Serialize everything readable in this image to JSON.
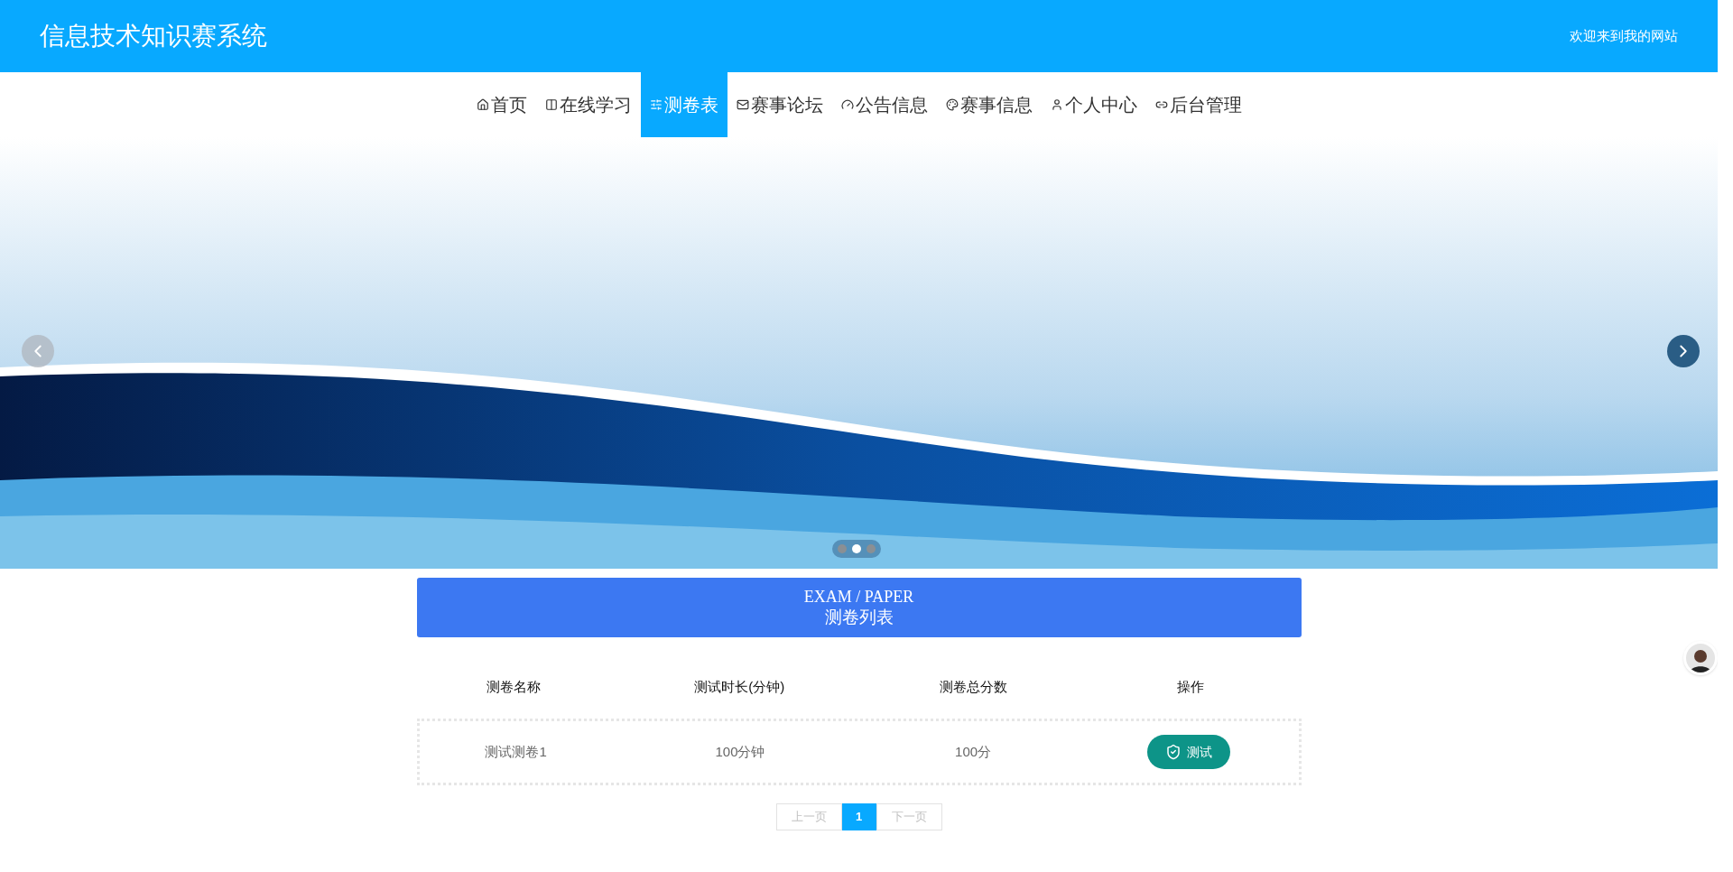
{
  "header": {
    "title": "信息技术知识赛系统",
    "welcome": "欢迎来到我的网站"
  },
  "nav": [
    {
      "label": "首页",
      "selected": false
    },
    {
      "label": "在线学习",
      "selected": false
    },
    {
      "label": "测卷表",
      "selected": true
    },
    {
      "label": "赛事论坛",
      "selected": false
    },
    {
      "label": "公告信息",
      "selected": false
    },
    {
      "label": "赛事信息",
      "selected": false
    },
    {
      "label": "个人中心",
      "selected": false
    },
    {
      "label": "后台管理",
      "selected": false
    }
  ],
  "carousel": {
    "dots": [
      {
        "selected": false
      },
      {
        "selected": true
      },
      {
        "selected": false
      }
    ]
  },
  "section": {
    "title_en": "EXAM / PAPER",
    "title_zh": "测卷列表"
  },
  "table": {
    "columns": [
      "测卷名称",
      "测试时长(分钟)",
      "测卷总分数",
      "操作"
    ],
    "rows": [
      {
        "cells": [
          "测试测卷1",
          "100分钟",
          "100分"
        ],
        "action": "测试"
      }
    ]
  },
  "pagination": {
    "prev": {
      "label": "上一页",
      "disabled": true
    },
    "pages": [
      {
        "label": "1",
        "selected": true
      }
    ],
    "next": {
      "label": "下一页",
      "disabled": true
    }
  }
}
